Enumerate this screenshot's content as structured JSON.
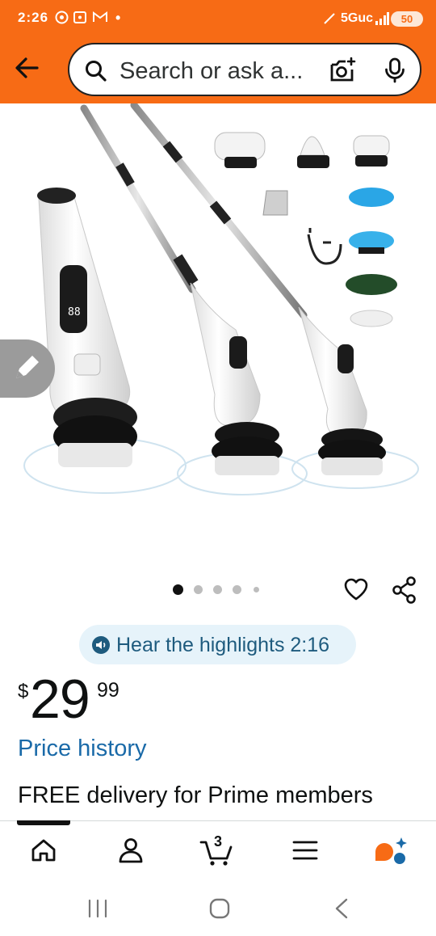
{
  "status_bar": {
    "time": "2:26",
    "network": "5Guc",
    "battery": "50",
    "dot": "•"
  },
  "header": {
    "search_placeholder": "Search or ask a..."
  },
  "gallery": {
    "image_count": 5,
    "selected_index": 0
  },
  "hear_highlights": {
    "label": "Hear the highlights 2:16"
  },
  "price": {
    "currency": "$",
    "whole": "29",
    "fraction": "99"
  },
  "price_history_label": "Price history",
  "delivery_text": "FREE delivery for Prime members",
  "bottom_nav": {
    "cart_count": "3"
  },
  "colors": {
    "header": "#f76b15",
    "link": "#1a6aa8",
    "hear_bg": "#e6f3fa"
  }
}
